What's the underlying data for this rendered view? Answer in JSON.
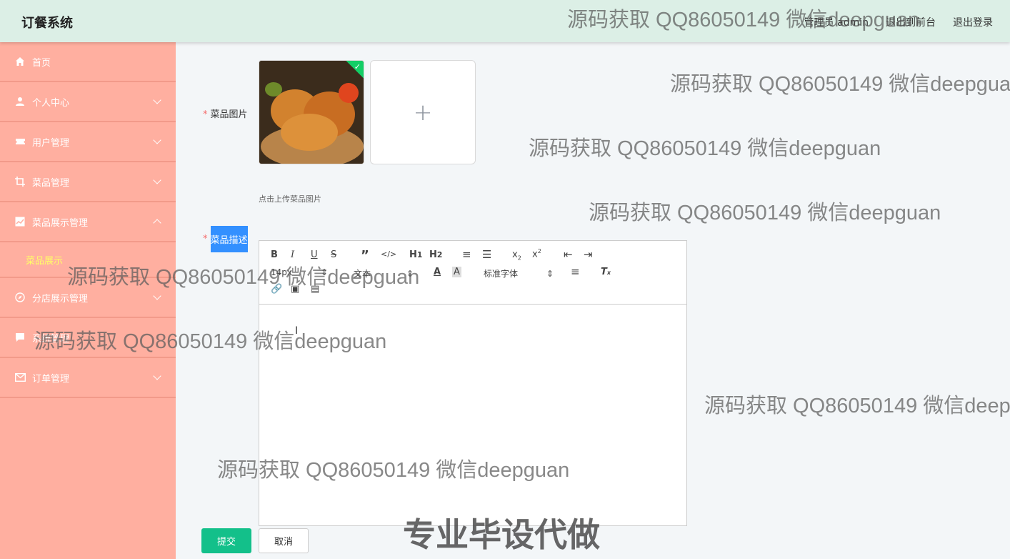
{
  "header": {
    "app_title": "订餐系统",
    "user_label": "管理员 admin",
    "front_label": "退出到前台",
    "logout_label": "退出登录"
  },
  "sidebar": {
    "items": [
      {
        "label": "首页",
        "icon": "home-icon"
      },
      {
        "label": "个人中心",
        "icon": "user-icon"
      },
      {
        "label": "用户管理",
        "icon": "ticket-icon"
      },
      {
        "label": "菜品管理",
        "icon": "crop-icon"
      },
      {
        "label": "菜品展示管理",
        "icon": "chart-icon"
      },
      {
        "label": "分店展示管理",
        "icon": "compass-icon"
      },
      {
        "label": "系统管理",
        "icon": "message-icon"
      },
      {
        "label": "订单管理",
        "icon": "mail-icon"
      }
    ],
    "submenu_label": "菜品展示"
  },
  "form": {
    "image_label": "菜品图片",
    "upload_tip": "点击上传菜品图片",
    "desc_label": "菜品描述",
    "submit_label": "提交",
    "cancel_label": "取消"
  },
  "editor": {
    "size_value": "14px",
    "text_value": "文本",
    "font_value": "标准字体"
  },
  "watermark": {
    "text": "源码获取 QQ86050149 微信deepguan",
    "big_text": "专业毕设代做"
  },
  "colors": {
    "header_bg": "#dcefe6",
    "sidebar_bg": "#ffafa0",
    "submit_bg": "#13c08a",
    "submenu_text": "#ffff66",
    "selection_bg": "#3390ff"
  }
}
